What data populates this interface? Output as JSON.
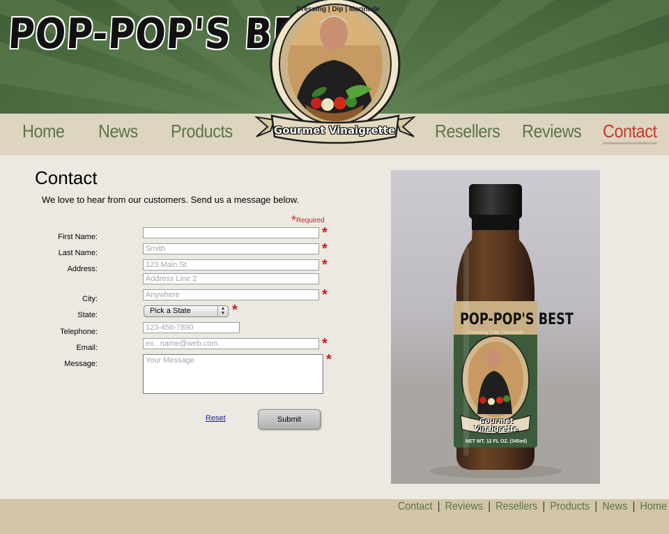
{
  "brand": {
    "name": "POP-POP'S BEST"
  },
  "badge": {
    "top_text": "Dressing | Dip | Marinade",
    "ribbon_text": "Gourmet Vinaigrette"
  },
  "nav": {
    "items": [
      {
        "label": "Home"
      },
      {
        "label": "News"
      },
      {
        "label": "Products"
      },
      {
        "label": "Resellers"
      },
      {
        "label": "Reviews"
      },
      {
        "label": "Contact"
      }
    ],
    "active": "Contact"
  },
  "page": {
    "title": "Contact",
    "intro": "We love to hear from our customers. Send us a message below.",
    "required_note": "Required",
    "required_star": "*"
  },
  "form": {
    "first_name": {
      "label": "First Name:",
      "value": "",
      "placeholder": ""
    },
    "last_name": {
      "label": "Last Name:",
      "value": "",
      "placeholder": "Smith"
    },
    "address": {
      "label": "Address:",
      "value": "",
      "placeholder": "123 Main St."
    },
    "address2": {
      "value": "",
      "placeholder": "Address Line 2"
    },
    "city": {
      "label": "City:",
      "value": "",
      "placeholder": "Anywhere"
    },
    "state": {
      "label": "State:",
      "selected": "Pick a State"
    },
    "telephone": {
      "label": "Telephone:",
      "value": "",
      "placeholder": "123-456-7890"
    },
    "email": {
      "label": "Email:",
      "value": "",
      "placeholder": "ex.  name@web.com"
    },
    "message": {
      "label": "Message:",
      "value": "",
      "placeholder": "Your Message"
    },
    "reset_label": "Reset",
    "submit_label": "Submit"
  },
  "photo": {
    "label_title": "POP-POP'S BEST",
    "label_sub": "Dressing | Dip | Marinade",
    "label_ribbon": "Gourmet Vinaigrette",
    "net_wt": "NET WT. 12 FL OZ. (345ml)"
  },
  "footer": {
    "links": [
      {
        "label": "Contact"
      },
      {
        "label": "Reviews"
      },
      {
        "label": "Resellers"
      },
      {
        "label": "Products"
      },
      {
        "label": "News"
      },
      {
        "label": "Home"
      }
    ],
    "separator": "|"
  },
  "colors": {
    "header_green": "#4a6a3f",
    "nav_bg": "#ddd5c0",
    "nav_text": "#5d7447",
    "active_text": "#c4392c",
    "required_red": "#c71f1f",
    "footer_bg": "#d2c5a8",
    "content_bg": "#ebe9e1"
  },
  "icons": {
    "required": "asterisk-icon",
    "select_arrows": "up-down-chevron-icon"
  }
}
